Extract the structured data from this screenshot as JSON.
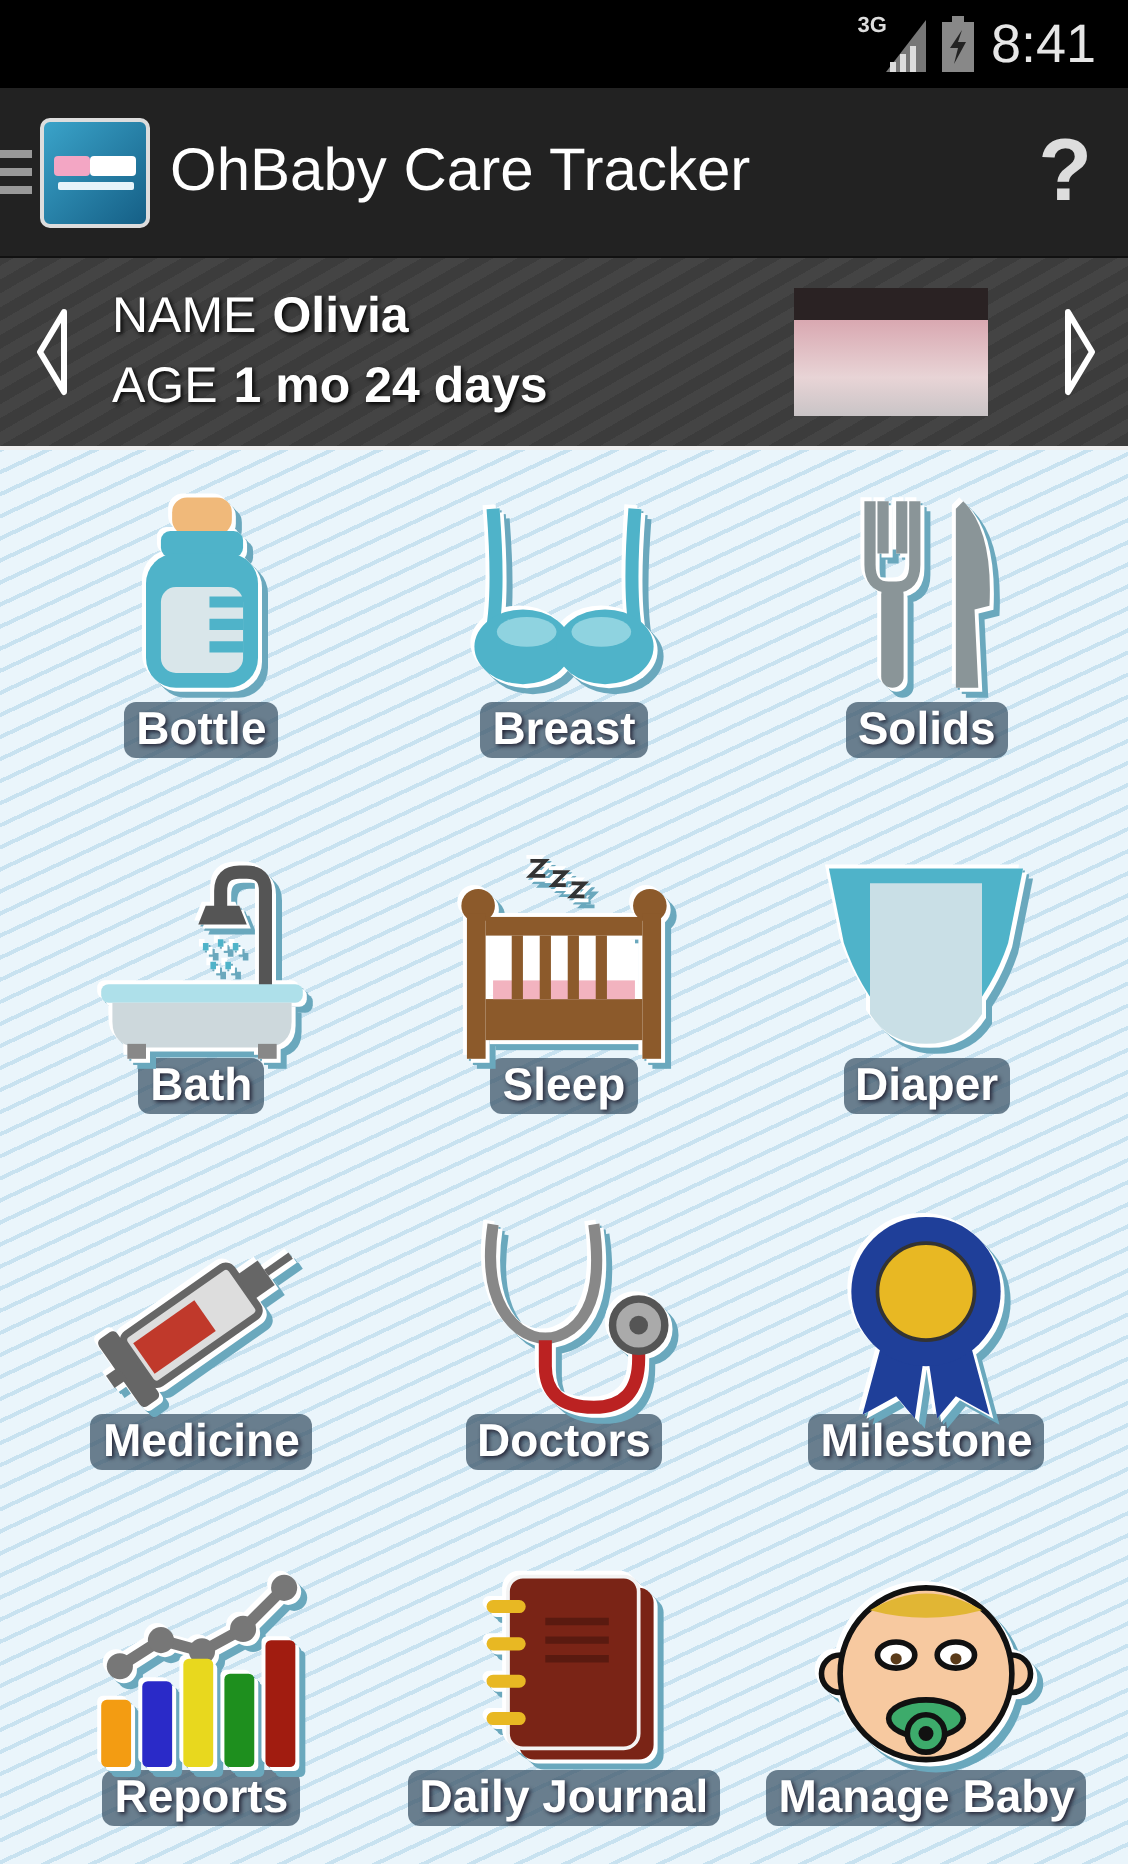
{
  "status_bar": {
    "network": "3G",
    "time": "8:41"
  },
  "app_bar": {
    "title": "OhBaby Care Tracker",
    "help": "?"
  },
  "baby": {
    "name_label": "NAME",
    "name": "Olivia",
    "age_label": "AGE",
    "age": "1 mo 24 days"
  },
  "tiles": [
    {
      "label": "Bottle"
    },
    {
      "label": "Breast"
    },
    {
      "label": "Solids"
    },
    {
      "label": "Bath"
    },
    {
      "label": "Sleep"
    },
    {
      "label": "Diaper"
    },
    {
      "label": "Medicine"
    },
    {
      "label": "Doctors"
    },
    {
      "label": "Milestone"
    },
    {
      "label": "Reports"
    },
    {
      "label": "Daily Journal"
    },
    {
      "label": "Manage Baby"
    }
  ]
}
